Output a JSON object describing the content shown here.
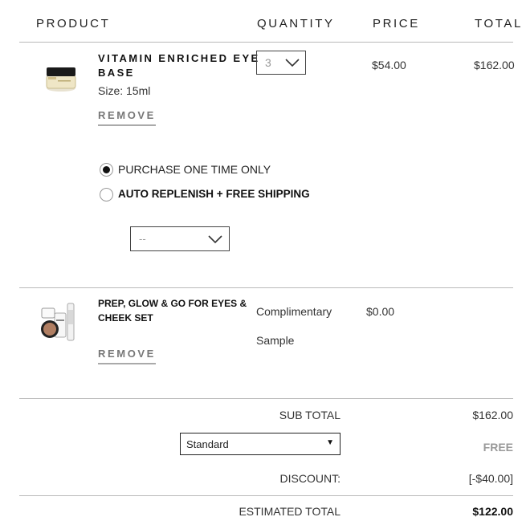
{
  "header": {
    "product": "PRODUCT",
    "quantity": "QUANTITY",
    "price": "PRICE",
    "total": "TOTAL"
  },
  "item1": {
    "name_line1": "VITAMIN ENRICHED EYE",
    "name_line2": "BASE",
    "size": "Size: 15ml",
    "remove": "REMOVE",
    "quantity": "3",
    "price": "$54.00",
    "total": "$162.00",
    "image_icon": "eye-base-jar-icon"
  },
  "purchase_options": {
    "one_time": "PURCHASE ONE TIME ONLY",
    "one_time_selected": true,
    "auto_replenish": "AUTO REPLENISH + FREE SHIPPING",
    "frequency_value": "--"
  },
  "item2": {
    "name_line1": "PREP, GLOW & GO FOR EYES &",
    "name_line2": "CHEEK SET",
    "remove": "REMOVE",
    "quantity_label": "Complimentary",
    "quantity_label2": "Sample",
    "price": "$0.00",
    "image_icon": "makeup-set-icon"
  },
  "summary": {
    "subtotal_label": "SUB TOTAL",
    "subtotal_value": "$162.00",
    "shipping_method": "Standard",
    "shipping_value": "FREE",
    "discount_label": "DISCOUNT:",
    "discount_value": "[-$40.00]",
    "estimated_label": "ESTIMATED TOTAL",
    "estimated_value": "$122.00"
  },
  "colors": {
    "divider": "#b9b9b9",
    "text": "#222222",
    "muted": "#777777"
  }
}
